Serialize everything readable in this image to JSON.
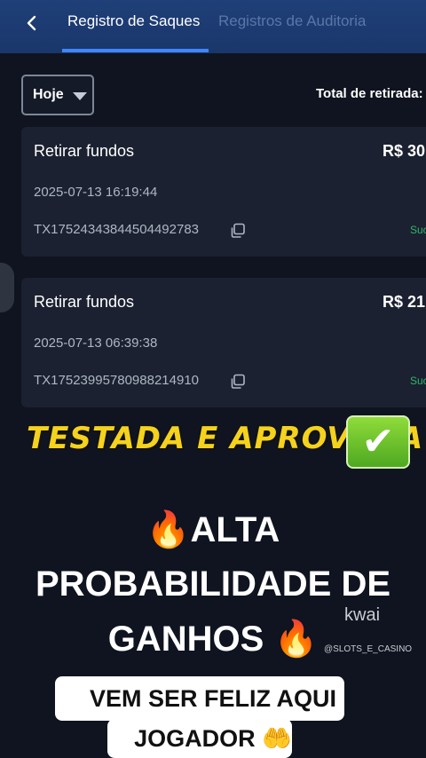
{
  "header": {
    "tabs": [
      {
        "label": "Registro de Saques",
        "active": true
      },
      {
        "label": "Registros de Auditoria",
        "active": false
      }
    ]
  },
  "filter": {
    "selected": "Hoje"
  },
  "summary": {
    "total_label": "Total de retirada:"
  },
  "records": [
    {
      "title": "Retirar fundos",
      "amount": "R$ 30",
      "date": "2025-07-13 16:19:44",
      "tx": "TX17524343844504492783",
      "status": "Suc"
    },
    {
      "title": "Retirar fundos",
      "amount": "R$ 21",
      "date": "2025-07-13 06:39:38",
      "tx": "TX17523995780988214910",
      "status": "Suc"
    }
  ],
  "overlay": {
    "banner": "TESTADA E APROVADA",
    "line_1": "ALTA",
    "line_2": "PROBABILIDADE DE",
    "line_3": "GANHOS",
    "caption_1": "VEM SER FELIZ AQUI",
    "caption_2": "JOGADOR",
    "watermark": "kwai",
    "watermark_handle": "@SLOTS_E_CASINO"
  },
  "icons": {
    "back": "chevron-left-icon",
    "dropdown": "caret-down-icon",
    "copy": "copy-icon",
    "check": "check-mark-icon",
    "fire": "fire-emoji",
    "hands": "palms-up-emoji"
  },
  "colors": {
    "header_bg": "#1f3f78",
    "active_tab_underline": "#3f86ff",
    "inactive_tab": "#5b76a8",
    "page_bg": "#0f1420",
    "card_bg": "#1b2130",
    "status_success": "#2fb66a",
    "banner_yellow": "#f4d21d"
  }
}
